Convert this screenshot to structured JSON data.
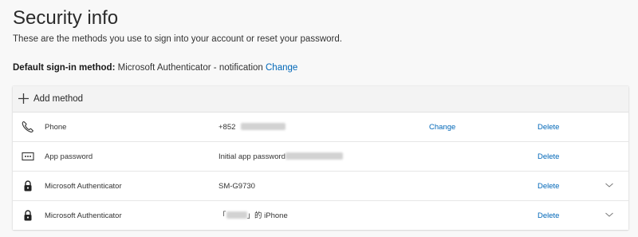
{
  "header": {
    "title": "Security info",
    "subtitle": "These are the methods you use to sign into your account or reset your password."
  },
  "default_method": {
    "label": "Default sign-in method:",
    "value": "Microsoft Authenticator - notification",
    "change_label": "Change"
  },
  "add_method": {
    "label": "Add method",
    "icon": "plus-icon"
  },
  "methods": [
    {
      "icon": "phone-icon",
      "name": "Phone",
      "detail": "+852",
      "change_label": "Change",
      "delete_label": "Delete"
    },
    {
      "icon": "password-icon",
      "name": "App password",
      "detail": "Initial app password",
      "delete_label": "Delete"
    },
    {
      "icon": "lock-icon",
      "name": "Microsoft Authenticator",
      "detail": "SM-G9730",
      "delete_label": "Delete",
      "expand_icon": "chevron-down-icon"
    },
    {
      "icon": "lock-icon",
      "name": "Microsoft Authenticator",
      "detail_prefix": "「",
      "detail_suffix": "」的 iPhone",
      "delete_label": "Delete",
      "expand_icon": "chevron-down-icon"
    }
  ],
  "colors": {
    "link": "#0067b8",
    "background": "#f8f8f8",
    "card": "#ffffff",
    "header_bar": "#f3f3f3"
  }
}
